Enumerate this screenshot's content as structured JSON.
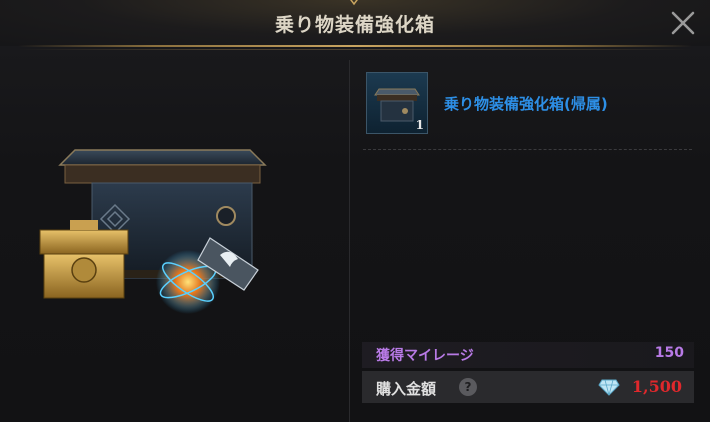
{
  "dialog": {
    "title": "乗り物装備強化箱",
    "close_icon": "close-icon"
  },
  "item": {
    "name": "乗り物装備強化箱(帰属)",
    "count": "1",
    "name_color": "#2d8fe6"
  },
  "mileage": {
    "label": "獲得マイレージ",
    "value": "150",
    "color": "#b87ae6"
  },
  "price": {
    "label": "購入金額",
    "help_icon": "?",
    "currency_icon": "diamond-icon",
    "value": "1,500",
    "color": "#e0282c"
  }
}
